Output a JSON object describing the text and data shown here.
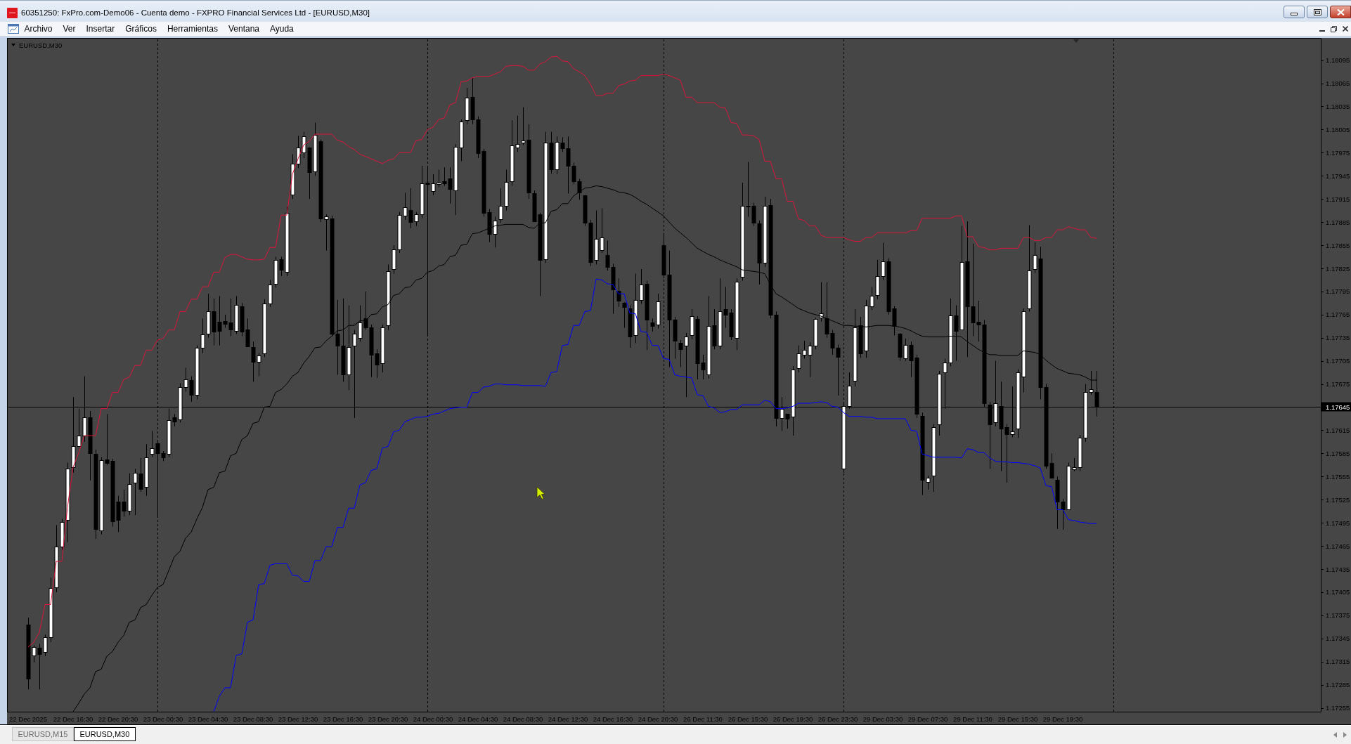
{
  "window": {
    "title": "60351250: FxPro.com-Demo06 - Cuenta demo - FXPRO Financial Services Ltd - [EURUSD,M30]"
  },
  "menu": [
    "Archivo",
    "Ver",
    "Insertar",
    "Gráficos",
    "Herramientas",
    "Ventana",
    "Ayuda"
  ],
  "chart": {
    "chart_data": [
      {
        "type": "candlestick",
        "title": "EURUSD,M30",
        "categories": [
          "22 Dec 2025",
          null,
          null,
          null,
          null,
          null,
          null,
          null,
          "22 Dec 16:30",
          null,
          null,
          null,
          null,
          null,
          null,
          null,
          "22 Dec 20:30",
          null,
          null,
          null,
          null,
          null,
          null,
          null,
          "23 Dec 00:30",
          null,
          null,
          null,
          null,
          null,
          null,
          null,
          "23 Dec 04:30",
          null,
          null,
          null,
          null,
          null,
          null,
          null,
          "23 Dec 08:30",
          null,
          null,
          null,
          null,
          null,
          null,
          null,
          "23 Dec 12:30",
          null,
          null,
          null,
          null,
          null,
          null,
          null,
          "23 Dec 16:30",
          null,
          null,
          null,
          null,
          null,
          null,
          null,
          "23 Dec 20:30",
          null,
          null,
          null,
          null,
          null,
          null,
          null,
          "24 Dec 00:30",
          null,
          null,
          null,
          null,
          null,
          null,
          null,
          "24 Dec 04:30",
          null,
          null,
          null,
          null,
          null,
          null,
          null,
          "24 Dec 08:30",
          null,
          null,
          null,
          null,
          null,
          null,
          null,
          "24 Dec 12:30",
          null,
          null,
          null,
          null,
          null,
          null,
          null,
          "24 Dec 16:30",
          null,
          null,
          null,
          null,
          null,
          null,
          null,
          "24 Dec 20:30",
          null,
          null,
          null,
          null,
          null,
          null,
          null,
          "26 Dec 11:30",
          null,
          null,
          null,
          null,
          null,
          null,
          null,
          "26 Dec 15:30",
          null,
          null,
          null,
          null,
          null,
          null,
          null,
          "26 Dec 19:30",
          null,
          null,
          null,
          null,
          null,
          null,
          null,
          "26 Dec 23:30",
          null,
          null,
          null,
          null,
          null,
          null,
          null,
          "29 Dec 03:30",
          null,
          null,
          null,
          null,
          null,
          null,
          null,
          "29 Dec 07:30",
          null,
          null,
          null,
          null,
          null,
          null,
          null,
          "29 Dec 11:30",
          null,
          null,
          null,
          null,
          null,
          null,
          null,
          "29 Dec 15:30",
          null,
          null,
          null,
          null,
          null,
          null,
          null,
          "29 Dec 19:30",
          null,
          null,
          null,
          null,
          null,
          null
        ],
        "ohlc": [
          [
            1.17363,
            1.17372,
            1.17279,
            1.17293
          ],
          [
            1.17323,
            1.17336,
            1.17314,
            1.17334
          ],
          [
            1.17333,
            1.17338,
            1.17279,
            1.17325
          ],
          [
            1.17327,
            1.1735,
            1.17322,
            1.17347
          ],
          [
            1.17347,
            1.17424,
            1.1734,
            1.1741
          ],
          [
            1.17411,
            1.17492,
            1.17405,
            1.17464
          ],
          [
            1.17464,
            1.175,
            1.1746,
            1.17496
          ],
          [
            1.17499,
            1.17573,
            1.1747,
            1.17565
          ],
          [
            1.17567,
            1.17658,
            1.1756,
            1.17594
          ],
          [
            1.17594,
            1.17643,
            1.17594,
            1.17608
          ],
          [
            1.17608,
            1.17685,
            1.176,
            1.17632
          ],
          [
            1.17632,
            1.1764,
            1.1755,
            1.17585
          ],
          [
            1.17584,
            1.1759,
            1.17474,
            1.17487
          ],
          [
            1.17485,
            1.1758,
            1.1748,
            1.17576
          ],
          [
            1.17577,
            1.17636,
            1.1757,
            1.17573
          ],
          [
            1.17575,
            1.17578,
            1.1749,
            1.17497
          ],
          [
            1.17522,
            1.1753,
            1.17483,
            1.17499
          ],
          [
            1.17522,
            1.17538,
            1.17503,
            1.17511
          ],
          [
            1.17511,
            1.17559,
            1.17505,
            1.17545
          ],
          [
            1.17547,
            1.17565,
            1.17505,
            1.1756
          ],
          [
            1.17559,
            1.17579,
            1.17535,
            1.17539
          ],
          [
            1.17542,
            1.17597,
            1.1753,
            1.1758
          ],
          [
            1.17584,
            1.17614,
            1.1758,
            1.17592
          ],
          [
            1.17598,
            1.176,
            1.17503,
            1.17585
          ],
          [
            1.17585,
            1.17588,
            1.17575,
            1.1758
          ],
          [
            1.17584,
            1.17643,
            1.1758,
            1.17628
          ],
          [
            1.17632,
            1.17636,
            1.1762,
            1.17626
          ],
          [
            1.17629,
            1.17676,
            1.17625,
            1.17671
          ],
          [
            1.17671,
            1.17696,
            1.17665,
            1.17681
          ],
          [
            1.1768,
            1.17685,
            1.17652,
            1.17661
          ],
          [
            1.17661,
            1.17725,
            1.17655,
            1.17722
          ],
          [
            1.17722,
            1.1776,
            1.17715,
            1.17739
          ],
          [
            1.1774,
            1.17792,
            1.17735,
            1.17769
          ],
          [
            1.17769,
            1.17786,
            1.17725,
            1.17743
          ],
          [
            1.17756,
            1.17789,
            1.17725,
            1.17744
          ],
          [
            1.17757,
            1.17765,
            1.17748,
            1.17753
          ],
          [
            1.17755,
            1.17786,
            1.17737,
            1.17746
          ],
          [
            1.17744,
            1.17789,
            1.1774,
            1.17778
          ],
          [
            1.17776,
            1.1778,
            1.17737,
            1.17743
          ],
          [
            1.17746,
            1.1776,
            1.17724,
            1.17724
          ],
          [
            1.17723,
            1.1773,
            1.17678,
            1.17704
          ],
          [
            1.17704,
            1.17715,
            1.17685,
            1.17712
          ],
          [
            1.17715,
            1.17785,
            1.1771,
            1.17779
          ],
          [
            1.17779,
            1.1781,
            1.17775,
            1.17804
          ],
          [
            1.17805,
            1.1784,
            1.178,
            1.17836
          ],
          [
            1.17837,
            1.1784,
            1.17815,
            1.17823
          ],
          [
            1.1782,
            1.17905,
            1.17815,
            1.17897
          ],
          [
            1.17921,
            1.17973,
            1.17915,
            1.17961
          ],
          [
            1.17961,
            1.17997,
            1.17955,
            1.17982
          ],
          [
            1.17975,
            1.18002,
            1.17968,
            1.17996
          ],
          [
            1.17982,
            1.17982,
            1.17915,
            1.1795
          ],
          [
            1.17951,
            1.18014,
            1.17945,
            1.17998
          ],
          [
            1.1799,
            1.17992,
            1.17885,
            1.1789
          ],
          [
            1.17889,
            1.17895,
            1.17848,
            1.17892
          ],
          [
            1.1789,
            1.17893,
            1.17737,
            1.1774
          ],
          [
            1.1774,
            1.17784,
            1.17687,
            1.17725
          ],
          [
            1.17725,
            1.17786,
            1.17678,
            1.17687
          ],
          [
            1.17687,
            1.17777,
            1.17667,
            1.17723
          ],
          [
            1.17725,
            1.17745,
            1.17631,
            1.1774
          ],
          [
            1.17735,
            1.17777,
            1.1773,
            1.17755
          ],
          [
            1.1776,
            1.17795,
            1.17745,
            1.17748
          ],
          [
            1.17748,
            1.17752,
            1.17684,
            1.17713
          ],
          [
            1.17715,
            1.1772,
            1.17683,
            1.177
          ],
          [
            1.17702,
            1.17752,
            1.1769,
            1.17748
          ],
          [
            1.17751,
            1.1783,
            1.17745,
            1.17821
          ],
          [
            1.17824,
            1.17855,
            1.17818,
            1.1785
          ],
          [
            1.1785,
            1.17898,
            1.17845,
            1.17894
          ],
          [
            1.17893,
            1.17923,
            1.17888,
            1.17904
          ],
          [
            1.17901,
            1.17929,
            1.17877,
            1.17885
          ],
          [
            1.17886,
            1.17898,
            1.1788,
            1.17895
          ],
          [
            1.17895,
            1.17958,
            1.1789,
            1.17935
          ],
          [
            1.17936,
            1.17958,
            1.17737,
            1.17934
          ],
          [
            1.17925,
            1.17947,
            1.1792,
            1.17935
          ],
          [
            1.17934,
            1.17953,
            1.1793,
            1.17936
          ],
          [
            1.17938,
            1.17956,
            1.17932,
            1.17935
          ],
          [
            1.17942,
            1.17956,
            1.17909,
            1.17928
          ],
          [
            1.17926,
            1.17986,
            1.17894,
            1.17983
          ],
          [
            1.17982,
            1.18018,
            1.17964,
            1.18015
          ],
          [
            1.18017,
            1.18059,
            1.18012,
            1.18046
          ],
          [
            1.18047,
            1.18072,
            1.18012,
            1.18018
          ],
          [
            1.18018,
            1.18022,
            1.17968,
            1.17974
          ],
          [
            1.17977,
            1.1798,
            1.17892,
            1.17897
          ],
          [
            1.17898,
            1.17902,
            1.17859,
            1.1787
          ],
          [
            1.1787,
            1.17892,
            1.17852,
            1.17887
          ],
          [
            1.17889,
            1.17929,
            1.17884,
            1.17906
          ],
          [
            1.17906,
            1.17953,
            1.179,
            1.17937
          ],
          [
            1.17938,
            1.18017,
            1.17932,
            1.17984
          ],
          [
            1.17982,
            1.18023,
            1.17976,
            1.17986
          ],
          [
            1.17988,
            1.18034,
            1.17985,
            1.17991
          ],
          [
            1.17992,
            1.18012,
            1.17915,
            1.17923
          ],
          [
            1.17922,
            1.17926,
            1.17886,
            1.17886
          ],
          [
            1.17895,
            1.17897,
            1.17789,
            1.17836
          ],
          [
            1.17837,
            1.18002,
            1.17832,
            1.17988
          ],
          [
            1.17988,
            1.18002,
            1.17948,
            1.17953
          ],
          [
            1.17953,
            1.17996,
            1.17947,
            1.17989
          ],
          [
            1.17988,
            1.17995,
            1.17976,
            1.17981
          ],
          [
            1.17981,
            1.17996,
            1.17922,
            1.17958
          ],
          [
            1.17958,
            1.17962,
            1.17934,
            1.17938
          ],
          [
            1.17938,
            1.17941,
            1.17914,
            1.17923
          ],
          [
            1.1792,
            1.1792,
            1.1788,
            1.17884
          ],
          [
            1.17884,
            1.17888,
            1.17828,
            1.17833
          ],
          [
            1.17836,
            1.179,
            1.1783,
            1.17863
          ],
          [
            1.17849,
            1.17903,
            1.17845,
            1.17865
          ],
          [
            1.17842,
            1.17861,
            1.17822,
            1.17827
          ],
          [
            1.17827,
            1.17831,
            1.17766,
            1.17798
          ],
          [
            1.17796,
            1.17812,
            1.17775,
            1.17783
          ],
          [
            1.1778,
            1.17781,
            1.17748,
            1.17775
          ],
          [
            1.17773,
            1.17777,
            1.17722,
            1.17737
          ],
          [
            1.17738,
            1.17818,
            1.17728,
            1.17784
          ],
          [
            1.17784,
            1.17824,
            1.17779,
            1.17804
          ],
          [
            1.17805,
            1.17809,
            1.17719,
            1.17758
          ],
          [
            1.17755,
            1.1776,
            1.17743,
            1.1775
          ],
          [
            1.17752,
            1.17792,
            1.17747,
            1.17782
          ],
          [
            1.17855,
            1.17871,
            1.17812,
            1.17817
          ],
          [
            1.17817,
            1.17848,
            1.17697,
            1.17758
          ],
          [
            1.17758,
            1.17762,
            1.17708,
            1.17731
          ],
          [
            1.17728,
            1.17732,
            1.17697,
            1.1772
          ],
          [
            1.17725,
            1.17741,
            1.17658,
            1.17737
          ],
          [
            1.17738,
            1.17772,
            1.17733,
            1.17763
          ],
          [
            1.17759,
            1.17763,
            1.17681,
            1.17702
          ],
          [
            1.17703,
            1.17713,
            1.17681,
            1.17694
          ],
          [
            1.17687,
            1.17789,
            1.17682,
            1.1775
          ],
          [
            1.17751,
            1.17772,
            1.1772,
            1.17725
          ],
          [
            1.17725,
            1.17812,
            1.1772,
            1.17769
          ],
          [
            1.17772,
            1.17801,
            1.17748,
            1.17765
          ],
          [
            1.17768,
            1.17772,
            1.17732,
            1.17737
          ],
          [
            1.17735,
            1.17812,
            1.17719,
            1.17808
          ],
          [
            1.17814,
            1.17936,
            1.17809,
            1.17906
          ],
          [
            1.17906,
            1.17963,
            1.17892,
            1.17905
          ],
          [
            1.17906,
            1.1791,
            1.1788,
            1.17884
          ],
          [
            1.17883,
            1.17887,
            1.17804,
            1.17832
          ],
          [
            1.17832,
            1.17918,
            1.17827,
            1.17906
          ],
          [
            1.17907,
            1.17915,
            1.1776,
            1.17765
          ],
          [
            1.17765,
            1.17769,
            1.1762,
            1.17631
          ],
          [
            1.17631,
            1.17658,
            1.17614,
            1.17643
          ],
          [
            1.17636,
            1.17636,
            1.17617,
            1.1763
          ],
          [
            1.17633,
            1.17698,
            1.17608,
            1.17694
          ],
          [
            1.17696,
            1.17725,
            1.1769,
            1.17715
          ],
          [
            1.17713,
            1.17731,
            1.17708,
            1.17719
          ],
          [
            1.17713,
            1.17729,
            1.17684,
            1.17725
          ],
          [
            1.17725,
            1.17761,
            1.1772,
            1.17759
          ],
          [
            1.17761,
            1.17807,
            1.17756,
            1.17767
          ],
          [
            1.1776,
            1.17807,
            1.17735,
            1.1774
          ],
          [
            1.17741,
            1.17745,
            1.17713,
            1.17722
          ],
          [
            1.17722,
            1.17726,
            1.1766,
            1.1771
          ],
          [
            1.17565,
            1.1765,
            1.1756,
            1.17646
          ],
          [
            1.17646,
            1.1769,
            1.17643,
            1.17673
          ],
          [
            1.17679,
            1.17772,
            1.17672,
            1.17748
          ],
          [
            1.17751,
            1.17762,
            1.17709,
            1.17715
          ],
          [
            1.17718,
            1.17784,
            1.17709,
            1.17777
          ],
          [
            1.17776,
            1.17801,
            1.17771,
            1.17789
          ],
          [
            1.1779,
            1.17836,
            1.17785,
            1.17815
          ],
          [
            1.17815,
            1.17858,
            1.1781,
            1.17834
          ],
          [
            1.17834,
            1.17838,
            1.17765,
            1.17769
          ],
          [
            1.17773,
            1.17776,
            1.17738,
            1.1775
          ],
          [
            1.1774,
            1.17741,
            1.17705,
            1.1771
          ],
          [
            1.17708,
            1.17734,
            1.17705,
            1.17726
          ],
          [
            1.17726,
            1.1773,
            1.17684,
            1.17706
          ],
          [
            1.17709,
            1.17713,
            1.17631,
            1.17636
          ],
          [
            1.17634,
            1.17638,
            1.17531,
            1.17551
          ],
          [
            1.17548,
            1.17556,
            1.17538,
            1.17553
          ],
          [
            1.17556,
            1.17623,
            1.17535,
            1.17619
          ],
          [
            1.17623,
            1.17692,
            1.17608,
            1.17688
          ],
          [
            1.1769,
            1.17708,
            1.17643,
            1.17703
          ],
          [
            1.17703,
            1.17786,
            1.17698,
            1.17764
          ],
          [
            1.17764,
            1.17777,
            1.17705,
            1.17744
          ],
          [
            1.17746,
            1.1788,
            1.17746,
            1.17833
          ],
          [
            1.17834,
            1.17886,
            1.1771,
            1.17776
          ],
          [
            1.17776,
            1.17857,
            1.17737,
            1.17755
          ],
          [
            1.17756,
            1.17783,
            1.1773,
            1.17752
          ],
          [
            1.17752,
            1.17758,
            1.17645,
            1.1765
          ],
          [
            1.17648,
            1.17652,
            1.17565,
            1.17623
          ],
          [
            1.17625,
            1.17705,
            1.1762,
            1.1765
          ],
          [
            1.17646,
            1.17678,
            1.17562,
            1.17617
          ],
          [
            1.17619,
            1.17623,
            1.17547,
            1.1761
          ],
          [
            1.1761,
            1.17672,
            1.17606,
            1.17614
          ],
          [
            1.17617,
            1.17694,
            1.17605,
            1.1769
          ],
          [
            1.17685,
            1.17773,
            1.17664,
            1.17769
          ],
          [
            1.17773,
            1.17881,
            1.17769,
            1.17822
          ],
          [
            1.17824,
            1.17859,
            1.17819,
            1.17842
          ],
          [
            1.17838,
            1.17853,
            1.17655,
            1.17671
          ],
          [
            1.17671,
            1.17675,
            1.17565,
            1.17569
          ],
          [
            1.17573,
            1.17585,
            1.17553,
            1.17553
          ],
          [
            1.17551,
            1.17555,
            1.17487,
            1.17522
          ],
          [
            1.17522,
            1.17526,
            1.17486,
            1.17512
          ],
          [
            1.17512,
            1.17573,
            1.17512,
            1.17569
          ],
          [
            1.17564,
            1.17579,
            1.17562,
            1.17567
          ],
          [
            1.17567,
            1.17609,
            1.17562,
            1.17605
          ],
          [
            1.17605,
            1.17675,
            1.176,
            1.17665
          ],
          [
            1.17665,
            1.17692,
            1.17661,
            1.17668
          ],
          [
            1.17665,
            1.17692,
            1.17633,
            1.17645
          ]
        ],
        "series": [
          {
            "type": "line",
            "color": "#dc143c",
            "values": [
              1.17334,
              1.1734,
              1.17353,
              1.17389,
              1.17389,
              1.17445,
              1.17445,
              1.17515,
              1.17567,
              1.17586,
              1.17608,
              1.17608,
              1.17608,
              1.17643,
              1.17643,
              1.17664,
              1.17664,
              1.17681,
              1.17684,
              1.17699,
              1.17699,
              1.17719,
              1.17719,
              1.17732,
              1.17734,
              1.17745,
              1.17745,
              1.17769,
              1.17769,
              1.17785,
              1.17785,
              1.17801,
              1.17801,
              1.1782,
              1.1782,
              1.17839,
              1.17843,
              1.17843,
              1.1784,
              1.17837,
              1.17836,
              1.17836,
              1.17837,
              1.17852,
              1.17852,
              1.17894,
              1.17894,
              1.17947,
              1.17967,
              1.17985,
              1.1799,
              1.17999,
              1.17999,
              1.17999,
              1.17999,
              1.17991,
              1.17989,
              1.17983,
              1.17979,
              1.17973,
              1.1797,
              1.17967,
              1.17964,
              1.17961,
              1.17965,
              1.17967,
              1.17975,
              1.17975,
              1.17975,
              1.17991,
              1.17992,
              1.18005,
              1.18008,
              1.18018,
              1.1802,
              1.18037,
              1.1804,
              1.18067,
              1.18068,
              1.18072,
              1.18074,
              1.18074,
              1.18074,
              1.18077,
              1.1808,
              1.18087,
              1.18088,
              1.18088,
              1.18087,
              1.18082,
              1.18082,
              1.1809,
              1.18093,
              1.18099,
              1.181,
              1.18094,
              1.18093,
              1.18084,
              1.1808,
              1.18075,
              1.18064,
              1.18049,
              1.18049,
              1.18052,
              1.18052,
              1.18062,
              1.18064,
              1.18068,
              1.18069,
              1.18075,
              1.18075,
              1.18075,
              1.18075,
              1.18077,
              1.18075,
              1.18072,
              1.18069,
              1.18047,
              1.18047,
              1.1804,
              1.1804,
              1.1804,
              1.1804,
              1.18034,
              1.18033,
              1.18014,
              1.18013,
              1.17998,
              1.17998,
              1.17997,
              1.17992,
              1.17964,
              1.17964,
              1.17941,
              1.17941,
              1.17912,
              1.17912,
              1.17889,
              1.17887,
              1.1788,
              1.1788,
              1.17868,
              1.17865,
              1.17865,
              1.17865,
              1.17865,
              1.17862,
              1.1786,
              1.1786,
              1.17865,
              1.17865,
              1.17871,
              1.17871,
              1.17871,
              1.17871,
              1.17871,
              1.17871,
              1.17874,
              1.17874,
              1.1789,
              1.1789,
              1.1789,
              1.1789,
              1.1789,
              1.1789,
              1.17893,
              1.17893,
              1.17866,
              1.17866,
              1.17853,
              1.17852,
              1.17849,
              1.17849,
              1.17851,
              1.17851,
              1.17851,
              1.17851,
              1.17865,
              1.17865,
              1.17861,
              1.17861,
              1.17865,
              1.17865,
              1.17875,
              1.17875,
              1.17879,
              1.17877,
              1.17875,
              1.17875,
              1.17865,
              1.17864
            ]
          },
          {
            "type": "line",
            "color": "#000000",
            "values": [
              null,
              null,
              null,
              null,
              null,
              null,
              null,
              null,
              1.1725,
              1.17261,
              1.17273,
              1.17281,
              1.17302,
              1.17305,
              1.17322,
              1.17328,
              1.1734,
              1.17349,
              1.17366,
              1.17369,
              1.17385,
              1.17389,
              1.17401,
              1.17411,
              1.17415,
              1.17433,
              1.17451,
              1.17458,
              1.17475,
              1.17483,
              1.175,
              1.17515,
              1.17538,
              1.17541,
              1.1756,
              1.17562,
              1.17582,
              1.17585,
              1.17603,
              1.17608,
              1.17624,
              1.17626,
              1.17645,
              1.17646,
              1.17664,
              1.17668,
              1.17675,
              1.17685,
              1.1769,
              1.17702,
              1.17711,
              1.17722,
              1.17723,
              1.17731,
              1.17737,
              1.17744,
              1.17745,
              1.17751,
              1.17751,
              1.17757,
              1.17757,
              1.17765,
              1.17766,
              1.17775,
              1.17778,
              1.1779,
              1.17792,
              1.178,
              1.17801,
              1.1781,
              1.17812,
              1.1782,
              1.17822,
              1.17828,
              1.1783,
              1.1784,
              1.17842,
              1.17855,
              1.17856,
              1.1787,
              1.17871,
              1.17874,
              1.17877,
              1.1788,
              1.17881,
              1.17882,
              1.17882,
              1.17882,
              1.17882,
              1.17878,
              1.17877,
              1.17884,
              1.17884,
              1.17899,
              1.17901,
              1.17909,
              1.17909,
              1.17919,
              1.17924,
              1.17929,
              1.1793,
              1.17932,
              1.17931,
              1.17929,
              1.17927,
              1.17924,
              1.17923,
              1.17921,
              1.17917,
              1.17912,
              1.17908,
              1.17903,
              1.17898,
              1.17893,
              1.17885,
              1.17877,
              1.17871,
              1.17865,
              1.17858,
              1.17851,
              1.17847,
              1.17843,
              1.1784,
              1.17836,
              1.17833,
              1.1783,
              1.17827,
              1.17823,
              1.17822,
              1.17821,
              1.1782,
              1.17818,
              1.17804,
              1.17792,
              1.17788,
              1.17783,
              1.17778,
              1.17773,
              1.1777,
              1.17767,
              1.17765,
              1.17763,
              1.1776,
              1.17757,
              1.17754,
              1.17751,
              1.17751,
              1.1775,
              1.1775,
              1.17749,
              1.1775,
              1.17751,
              1.17751,
              1.17751,
              1.1775,
              1.17749,
              1.17747,
              1.17744,
              1.1774,
              1.17737,
              1.17736,
              1.17736,
              1.17736,
              1.17736,
              1.17737,
              1.17737,
              1.17736,
              1.1773,
              1.17725,
              1.1772,
              1.17716,
              1.17713,
              1.17713,
              1.17712,
              1.17712,
              1.17712,
              1.17712,
              1.17718,
              1.17717,
              1.17716,
              1.17713,
              1.17706,
              1.177,
              1.17695,
              1.17692,
              1.17689,
              1.17688,
              1.17687,
              1.17684,
              1.1768,
              1.1768
            ]
          },
          {
            "type": "line",
            "color": "#0000ff",
            "values": [
              null,
              null,
              null,
              null,
              null,
              null,
              null,
              null,
              null,
              null,
              null,
              null,
              null,
              null,
              null,
              null,
              null,
              null,
              null,
              null,
              null,
              null,
              null,
              null,
              null,
              null,
              null,
              null,
              null,
              null,
              null,
              null,
              null,
              1.1725,
              1.1727,
              1.17281,
              1.17281,
              1.17323,
              1.17325,
              1.17366,
              1.17369,
              1.17415,
              1.17416,
              1.1744,
              1.17442,
              1.17442,
              1.17442,
              1.17427,
              1.17426,
              1.17419,
              1.17419,
              1.17446,
              1.17446,
              1.17464,
              1.17464,
              1.17489,
              1.17489,
              1.17514,
              1.17514,
              1.17544,
              1.17547,
              1.17563,
              1.17565,
              1.17592,
              1.17594,
              1.17613,
              1.17615,
              1.17626,
              1.17629,
              1.17632,
              1.17632,
              1.17633,
              1.17636,
              1.17637,
              1.1764,
              1.17643,
              1.17644,
              1.17645,
              1.17645,
              1.17664,
              1.17664,
              1.17671,
              1.17672,
              1.17675,
              1.17675,
              1.17674,
              1.17674,
              1.17674,
              1.17673,
              1.17673,
              1.17673,
              1.17673,
              1.17672,
              1.1769,
              1.17691,
              1.17725,
              1.17726,
              1.17751,
              1.17751,
              1.17769,
              1.1777,
              1.17811,
              1.1781,
              1.17805,
              1.17804,
              1.17792,
              1.17792,
              1.17767,
              1.17766,
              1.17743,
              1.17742,
              1.17725,
              1.17725,
              1.17708,
              1.17707,
              1.17687,
              1.17685,
              1.17684,
              1.17683,
              1.17661,
              1.1766,
              1.17646,
              1.17644,
              1.17638,
              1.17639,
              1.17642,
              1.17642,
              1.17648,
              1.17648,
              1.17648,
              1.17648,
              1.17654,
              1.17652,
              1.17643,
              1.17643,
              1.17644,
              1.17646,
              1.1765,
              1.1765,
              1.1765,
              1.17651,
              1.17652,
              1.17651,
              1.17646,
              1.17645,
              1.17638,
              1.17633,
              1.17633,
              1.17633,
              1.17632,
              1.17632,
              1.1763,
              1.1763,
              1.1763,
              1.1763,
              1.1763,
              1.1763,
              1.17615,
              1.17614,
              1.17584,
              1.17582,
              1.1758,
              1.1758,
              1.1758,
              1.1758,
              1.1758,
              1.17579,
              1.17591,
              1.1759,
              1.17586,
              1.17586,
              1.17579,
              1.17575,
              1.17574,
              1.17574,
              1.17573,
              1.17573,
              1.17572,
              1.17571,
              1.17569,
              1.17566,
              1.17543,
              1.17542,
              1.17512,
              1.17512,
              1.17499,
              1.17498,
              1.17496,
              1.17495,
              1.17494,
              1.17494
            ]
          }
        ],
        "ylim": [
          1.1725,
          1.18122
        ],
        "yticks": [
          1.17255,
          1.17285,
          1.17315,
          1.17345,
          1.17375,
          1.17405,
          1.17435,
          1.17465,
          1.17495,
          1.17525,
          1.17555,
          1.17585,
          1.17615,
          1.17645,
          1.17675,
          1.17705,
          1.17735,
          1.17765,
          1.17795,
          1.17825,
          1.17855,
          1.17885,
          1.17915,
          1.17945,
          1.17975,
          1.18005,
          1.18035,
          1.18065,
          1.18095
        ],
        "ref_lines": [
          {
            "axis": "y",
            "value": 1.17645,
            "label": "1.17645",
            "color": "#000000"
          }
        ]
      }
    ]
  },
  "tabs": [
    {
      "label": "EURUSD,M15",
      "selected": false
    },
    {
      "label": "EURUSD,M30",
      "selected": true
    }
  ]
}
